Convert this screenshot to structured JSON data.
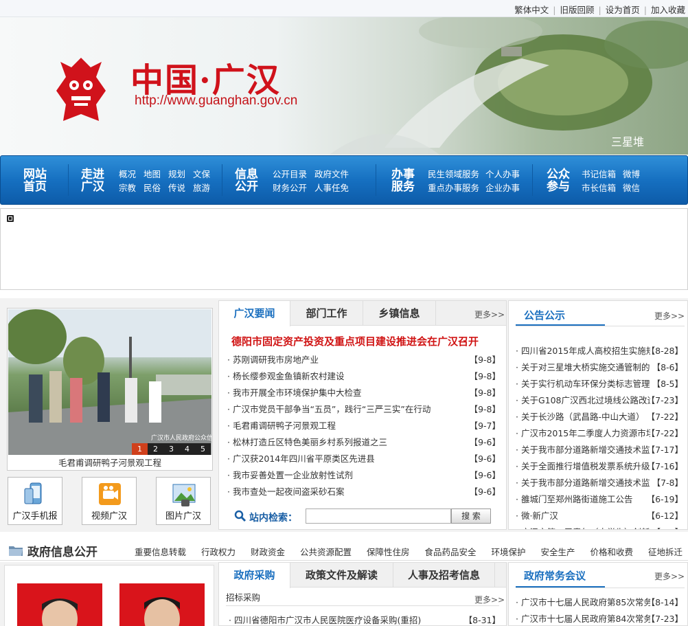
{
  "topbar": {
    "links": [
      "繁体中文",
      "旧版回顾",
      "设为首页",
      "加入收藏"
    ]
  },
  "banner": {
    "logo_text": "中国·广汉",
    "url_text": "http://www.guanghan.gov.cn",
    "caption": "三星堆"
  },
  "nav": {
    "home": "网站\n首页",
    "groups": [
      {
        "title": "走进\n广汉",
        "links": [
          "概况",
          "地图",
          "规划",
          "文保",
          "宗教",
          "民俗",
          "传说",
          "旅游"
        ]
      },
      {
        "title": "信息\n公开",
        "links": [
          "公开目录",
          "政府文件",
          "财务公开",
          "人事任免"
        ]
      },
      {
        "title": "办事\n服务",
        "links": [
          "民生领域服务",
          "个人办事",
          "重点办事服务",
          "企业办事"
        ]
      },
      {
        "title": "公众\n参与",
        "links": [
          "书记信箱",
          "微博",
          "市长信箱",
          "微信"
        ]
      }
    ]
  },
  "photo": {
    "caption": "毛君甫调研鸭子河景观工程",
    "pages": [
      "1",
      "2",
      "3",
      "4",
      "5"
    ],
    "watermark": "广汉市人民政府公众信息网"
  },
  "quicklinks": [
    "广汉手机报",
    "视频广汉",
    "图片广汉"
  ],
  "news": {
    "tabs": [
      "广汉要闻",
      "部门工作",
      "乡镇信息"
    ],
    "more": "更多>>",
    "headline": "德阳市固定资产投资及重点项目建设推进会在广汉召开",
    "items": [
      {
        "title": "苏刚调研我市房地产业",
        "date": "【9-8】"
      },
      {
        "title": "杨长缨参观金鱼镇新农村建设",
        "date": "【9-8】"
      },
      {
        "title": "我市开展全市环境保护集中大检查",
        "date": "【9-8】"
      },
      {
        "title": "广汉市党员干部争当“五员”，践行“三严三实”在行动",
        "date": "【9-8】"
      },
      {
        "title": "毛君甫调研鸭子河景观工程",
        "date": "【9-7】"
      },
      {
        "title": "松林打造丘区特色美丽乡村系列报道之三",
        "date": "【9-6】"
      },
      {
        "title": "广汉获2014年四川省平原类区先进县",
        "date": "【9-6】"
      },
      {
        "title": "我市妥善处置一企业放射性试剂",
        "date": "【9-6】"
      },
      {
        "title": "我市查处一起夜间盗采砂石案",
        "date": "【9-6】"
      }
    ],
    "search_label": "站内检索：",
    "search_value": "",
    "search_button": "搜 索"
  },
  "notice": {
    "title": "公告公示",
    "more": "更多>>",
    "items": [
      {
        "title": "四川省2015年成人高校招生实施规",
        "date": "【8-28】"
      },
      {
        "title": "关于对三星堆大桥实施交通管制的",
        "date": "【8-6】"
      },
      {
        "title": "关于实行机动车环保分类标志管理",
        "date": "【8-5】"
      },
      {
        "title": "关于G108广汉西北过境线公路改造",
        "date": "【7-23】"
      },
      {
        "title": "关于长沙路（武昌路-中山大道）",
        "date": "【7-22】"
      },
      {
        "title": "广汉市2015年二季度人力资源市场",
        "date": "【7-22】"
      },
      {
        "title": "关于我市部分道路新增交通技术监",
        "date": "【7-17】"
      },
      {
        "title": "关于全面推行增值税发票系统升级",
        "date": "【7-16】"
      },
      {
        "title": "关于我市部分道路新增交通技术监",
        "date": "【7-8】"
      },
      {
        "title": "雒城门至郑州路街道施工公告",
        "date": "【6-19】"
      },
      {
        "title": "微·新广汉",
        "date": "【6-12】"
      },
      {
        "title": "广汉市第一届青年（大学生）创新",
        "date": "【6-5】"
      }
    ]
  },
  "govbar": {
    "title": "政府信息公开",
    "items": [
      "重要信息转载",
      "行政权力",
      "财政资金",
      "公共资源配置",
      "保障性住房",
      "食品药品安全",
      "环境保护",
      "安全生产",
      "价格和收费",
      "征地拆迁"
    ]
  },
  "gov": {
    "tabs": [
      "政府采购",
      "政策文件及解读",
      "人事及招考信息"
    ],
    "sub_title": "招标采购",
    "more": "更多>>",
    "items": [
      {
        "title": "四川省德阳市广汉市人民医院医疗设备采购(重招)",
        "date": "【8-31】"
      }
    ]
  },
  "meet": {
    "title": "政府常务会议",
    "more": "更多>>",
    "items": [
      {
        "title": "广汉市十七届人民政府第85次常务",
        "date": "【8-14】"
      },
      {
        "title": "广汉市十七届人民政府第84次常务",
        "date": "【7-23】"
      }
    ]
  },
  "colors": {
    "brand_red": "#d0121b",
    "nav_blue": "#1670c1",
    "title_blue": "#1a6fbf"
  }
}
